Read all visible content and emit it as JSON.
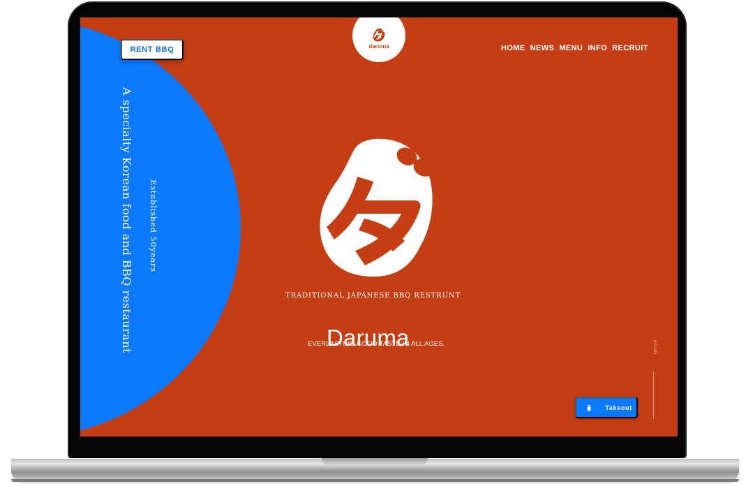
{
  "site": {
    "brand": "Daruma",
    "logo_text": "daruma",
    "hero_subtitle": "TRADITIONAL JAPANESE BBQ RESTRUNT",
    "slogan": "EVERLASTING GOOD TASTE-IN ALL AGES.",
    "vertical_tagline": "A specialty Korean food and BBQ restaurant",
    "established": "Established 50years",
    "logo_mark_icon": "daruma-logo-icon"
  },
  "buttons": {
    "rent": "RENT BBQ",
    "takeout": "Takeout",
    "takeout_icon": "shopping-bag-icon"
  },
  "nav": {
    "items": [
      {
        "label": "HOME"
      },
      {
        "label": "NEWS"
      },
      {
        "label": "MENU"
      },
      {
        "label": "INFO"
      },
      {
        "label": "RECRUIT"
      }
    ]
  },
  "scroll": {
    "label": "scroll"
  },
  "colors": {
    "primary_red": "#c53d12",
    "accent_blue": "#0a78ff",
    "white": "#ffffff"
  }
}
